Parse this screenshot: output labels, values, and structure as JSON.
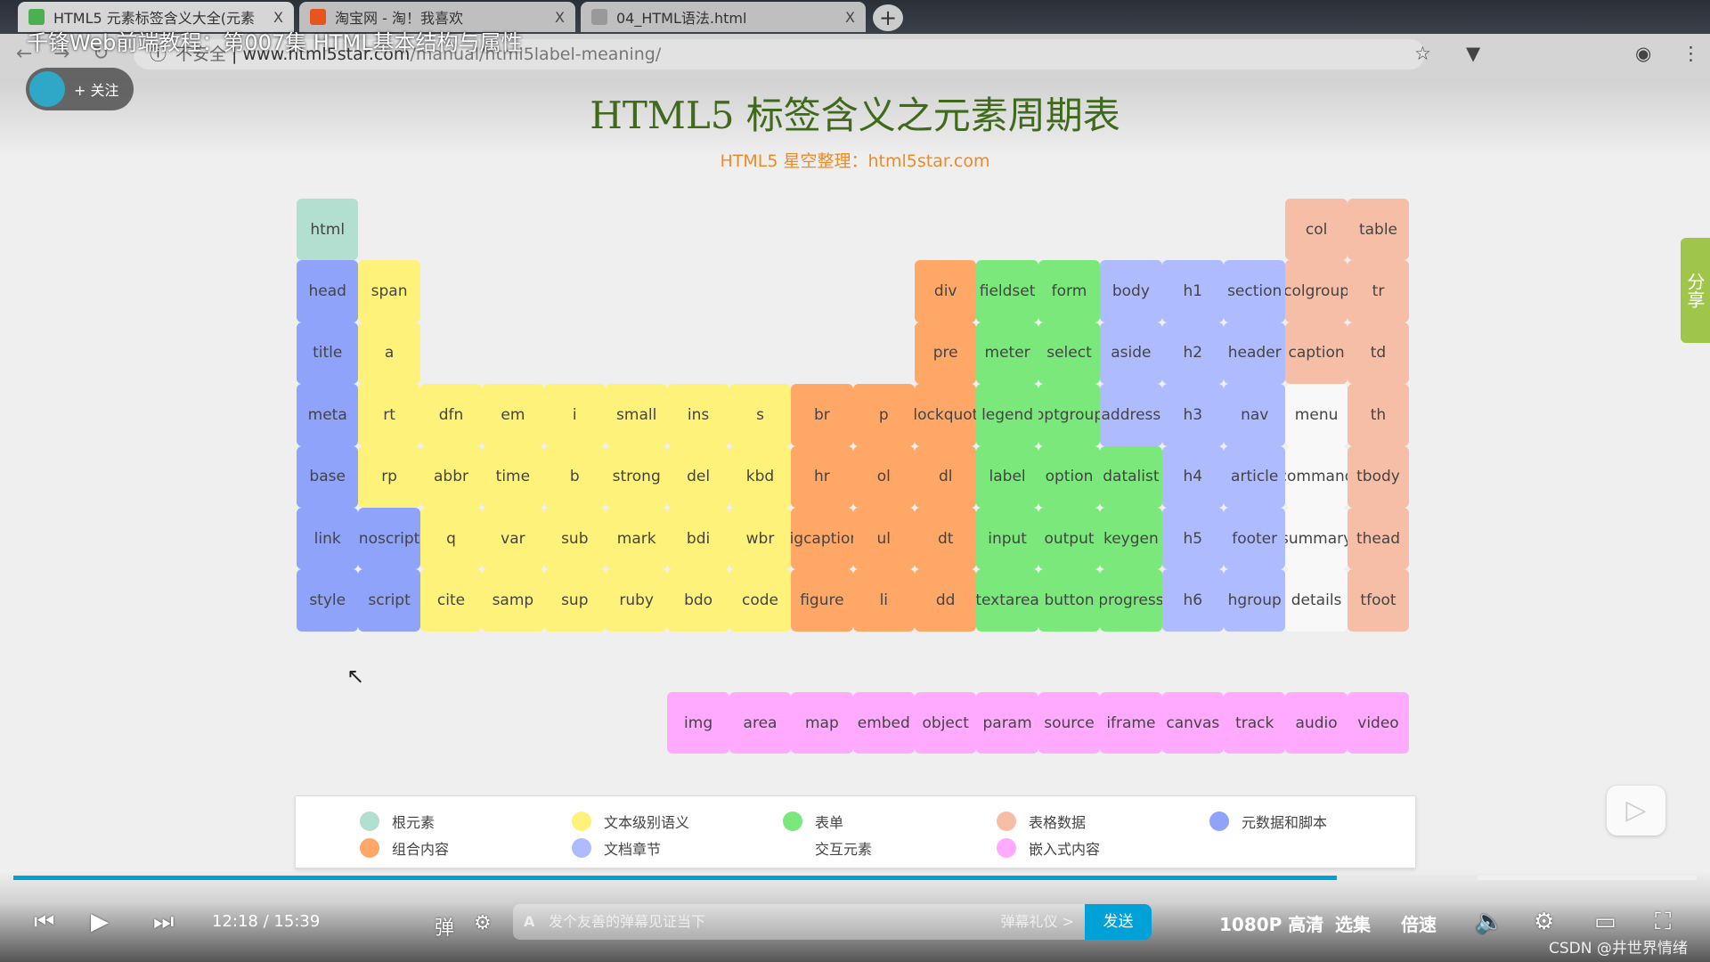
{
  "browser": {
    "tabs": [
      {
        "label": "HTML5 元素标签含义大全(元素",
        "active": true,
        "color": "#4caf50"
      },
      {
        "label": "淘宝网 - 淘！我喜欢",
        "active": false,
        "color": "#e8541e"
      },
      {
        "label": "04_HTML语法.html",
        "active": false,
        "color": "#999999"
      }
    ],
    "close_glyph": "X",
    "newtab_glyph": "+",
    "security": "不安全",
    "url_host": "www.html5star.com",
    "url_path": "/manual/html5label-meaning/"
  },
  "overlay": {
    "video_title": "千锋Web前端教程：第007集 HTML基本结构与属性",
    "follow_label": "+ 关注"
  },
  "page": {
    "title": "HTML5 标签含义之元素周期表",
    "subtitle": "HTML5 星空整理：html5star.com"
  },
  "colors": {
    "root": "#b2dfd0",
    "meta": "#8ea3f9",
    "text": "#fff27a",
    "form": "#7ae87a",
    "table": "#f6bea6",
    "group": "#ffa766",
    "section": "#aebcff",
    "interactive": "#f8f8f8",
    "embedded": "#ffaafe"
  },
  "table": {
    "rows": [
      [
        [
          "html",
          "root"
        ],
        null,
        null,
        null,
        null,
        null,
        null,
        null,
        null,
        null,
        null,
        null,
        null,
        null,
        null,
        null,
        [
          "col",
          "table"
        ],
        [
          "table",
          "table"
        ]
      ],
      [
        [
          "head",
          "meta"
        ],
        [
          "span",
          "text"
        ],
        null,
        null,
        null,
        null,
        null,
        null,
        null,
        null,
        [
          "div",
          "group"
        ],
        [
          "fieldset",
          "form"
        ],
        [
          "form",
          "form"
        ],
        [
          "body",
          "section"
        ],
        [
          "h1",
          "section"
        ],
        [
          "section",
          "section"
        ],
        [
          "colgroup",
          "table"
        ],
        [
          "tr",
          "table"
        ]
      ],
      [
        [
          "title",
          "meta"
        ],
        [
          "a",
          "text"
        ],
        null,
        null,
        null,
        null,
        null,
        null,
        null,
        null,
        [
          "pre",
          "group"
        ],
        [
          "meter",
          "form"
        ],
        [
          "select",
          "form"
        ],
        [
          "aside",
          "section"
        ],
        [
          "h2",
          "section"
        ],
        [
          "header",
          "section"
        ],
        [
          "caption",
          "table"
        ],
        [
          "td",
          "table"
        ]
      ],
      [
        [
          "meta",
          "meta"
        ],
        [
          "rt",
          "text"
        ],
        [
          "dfn",
          "text"
        ],
        [
          "em",
          "text"
        ],
        [
          "i",
          "text"
        ],
        [
          "small",
          "text"
        ],
        [
          "ins",
          "text"
        ],
        [
          "s",
          "text"
        ],
        [
          "br",
          "group"
        ],
        [
          "p",
          "group"
        ],
        [
          "blockquote",
          "group"
        ],
        [
          "legend",
          "form"
        ],
        [
          "optgroup",
          "form"
        ],
        [
          "address",
          "section"
        ],
        [
          "h3",
          "section"
        ],
        [
          "nav",
          "section"
        ],
        [
          "menu",
          "interactive"
        ],
        [
          "th",
          "table"
        ]
      ],
      [
        [
          "base",
          "meta"
        ],
        [
          "rp",
          "text"
        ],
        [
          "abbr",
          "text"
        ],
        [
          "time",
          "text"
        ],
        [
          "b",
          "text"
        ],
        [
          "strong",
          "text"
        ],
        [
          "del",
          "text"
        ],
        [
          "kbd",
          "text"
        ],
        [
          "hr",
          "group"
        ],
        [
          "ol",
          "group"
        ],
        [
          "dl",
          "group"
        ],
        [
          "label",
          "form"
        ],
        [
          "option",
          "form"
        ],
        [
          "datalist",
          "form"
        ],
        [
          "h4",
          "section"
        ],
        [
          "article",
          "section"
        ],
        [
          "command",
          "interactive"
        ],
        [
          "tbody",
          "table"
        ]
      ],
      [
        [
          "link",
          "meta"
        ],
        [
          "noscript",
          "meta"
        ],
        [
          "q",
          "text"
        ],
        [
          "var",
          "text"
        ],
        [
          "sub",
          "text"
        ],
        [
          "mark",
          "text"
        ],
        [
          "bdi",
          "text"
        ],
        [
          "wbr",
          "text"
        ],
        [
          "figcaption",
          "group"
        ],
        [
          "ul",
          "group"
        ],
        [
          "dt",
          "group"
        ],
        [
          "input",
          "form"
        ],
        [
          "output",
          "form"
        ],
        [
          "keygen",
          "form"
        ],
        [
          "h5",
          "section"
        ],
        [
          "footer",
          "section"
        ],
        [
          "summary",
          "interactive"
        ],
        [
          "thead",
          "table"
        ]
      ],
      [
        [
          "style",
          "meta"
        ],
        [
          "script",
          "meta"
        ],
        [
          "cite",
          "text"
        ],
        [
          "samp",
          "text"
        ],
        [
          "sup",
          "text"
        ],
        [
          "ruby",
          "text"
        ],
        [
          "bdo",
          "text"
        ],
        [
          "code",
          "text"
        ],
        [
          "figure",
          "group"
        ],
        [
          "li",
          "group"
        ],
        [
          "dd",
          "group"
        ],
        [
          "textarea",
          "form"
        ],
        [
          "button",
          "form"
        ],
        [
          "progress",
          "form"
        ],
        [
          "h6",
          "section"
        ],
        [
          "hgroup",
          "section"
        ],
        [
          "details",
          "interactive"
        ],
        [
          "tfoot",
          "table"
        ]
      ]
    ],
    "embedded": [
      null,
      null,
      null,
      null,
      null,
      null,
      [
        "img",
        "embedded"
      ],
      [
        "area",
        "embedded"
      ],
      [
        "map",
        "embedded"
      ],
      [
        "embed",
        "embedded"
      ],
      [
        "object",
        "embedded"
      ],
      [
        "param",
        "embedded"
      ],
      [
        "source",
        "embedded"
      ],
      [
        "iframe",
        "embedded"
      ],
      [
        "canvas",
        "embedded"
      ],
      [
        "track",
        "embedded"
      ],
      [
        "audio",
        "embedded"
      ],
      [
        "video",
        "embedded"
      ]
    ]
  },
  "legend": [
    {
      "label": "根元素",
      "cat": "root"
    },
    {
      "label": "文本级别语义",
      "cat": "text"
    },
    {
      "label": "表单",
      "cat": "form"
    },
    {
      "label": "表格数据",
      "cat": "table"
    },
    {
      "label": "元数据和脚本",
      "cat": "meta"
    },
    {
      "label": "组合内容",
      "cat": "group"
    },
    {
      "label": "文档章节",
      "cat": "section"
    },
    {
      "label": "交互元素",
      "cat": "interactive"
    },
    {
      "label": "嵌入式内容",
      "cat": "embedded"
    }
  ],
  "share_label": "分享",
  "player": {
    "current_time": "12:18",
    "separator": "/",
    "duration": "15:39",
    "played_fraction": 0.786,
    "buffered_fraction": 0.87,
    "danmaku_placeholder": "发个友善的弹幕见证当下",
    "danmaku_etiquette": "弹幕礼仪 >",
    "send_label": "发送",
    "quality": "1080P 高清",
    "episodes": "选集",
    "speed": "倍速",
    "accent": "#00a1d6"
  },
  "watermark": "CSDN @井世界情绪"
}
